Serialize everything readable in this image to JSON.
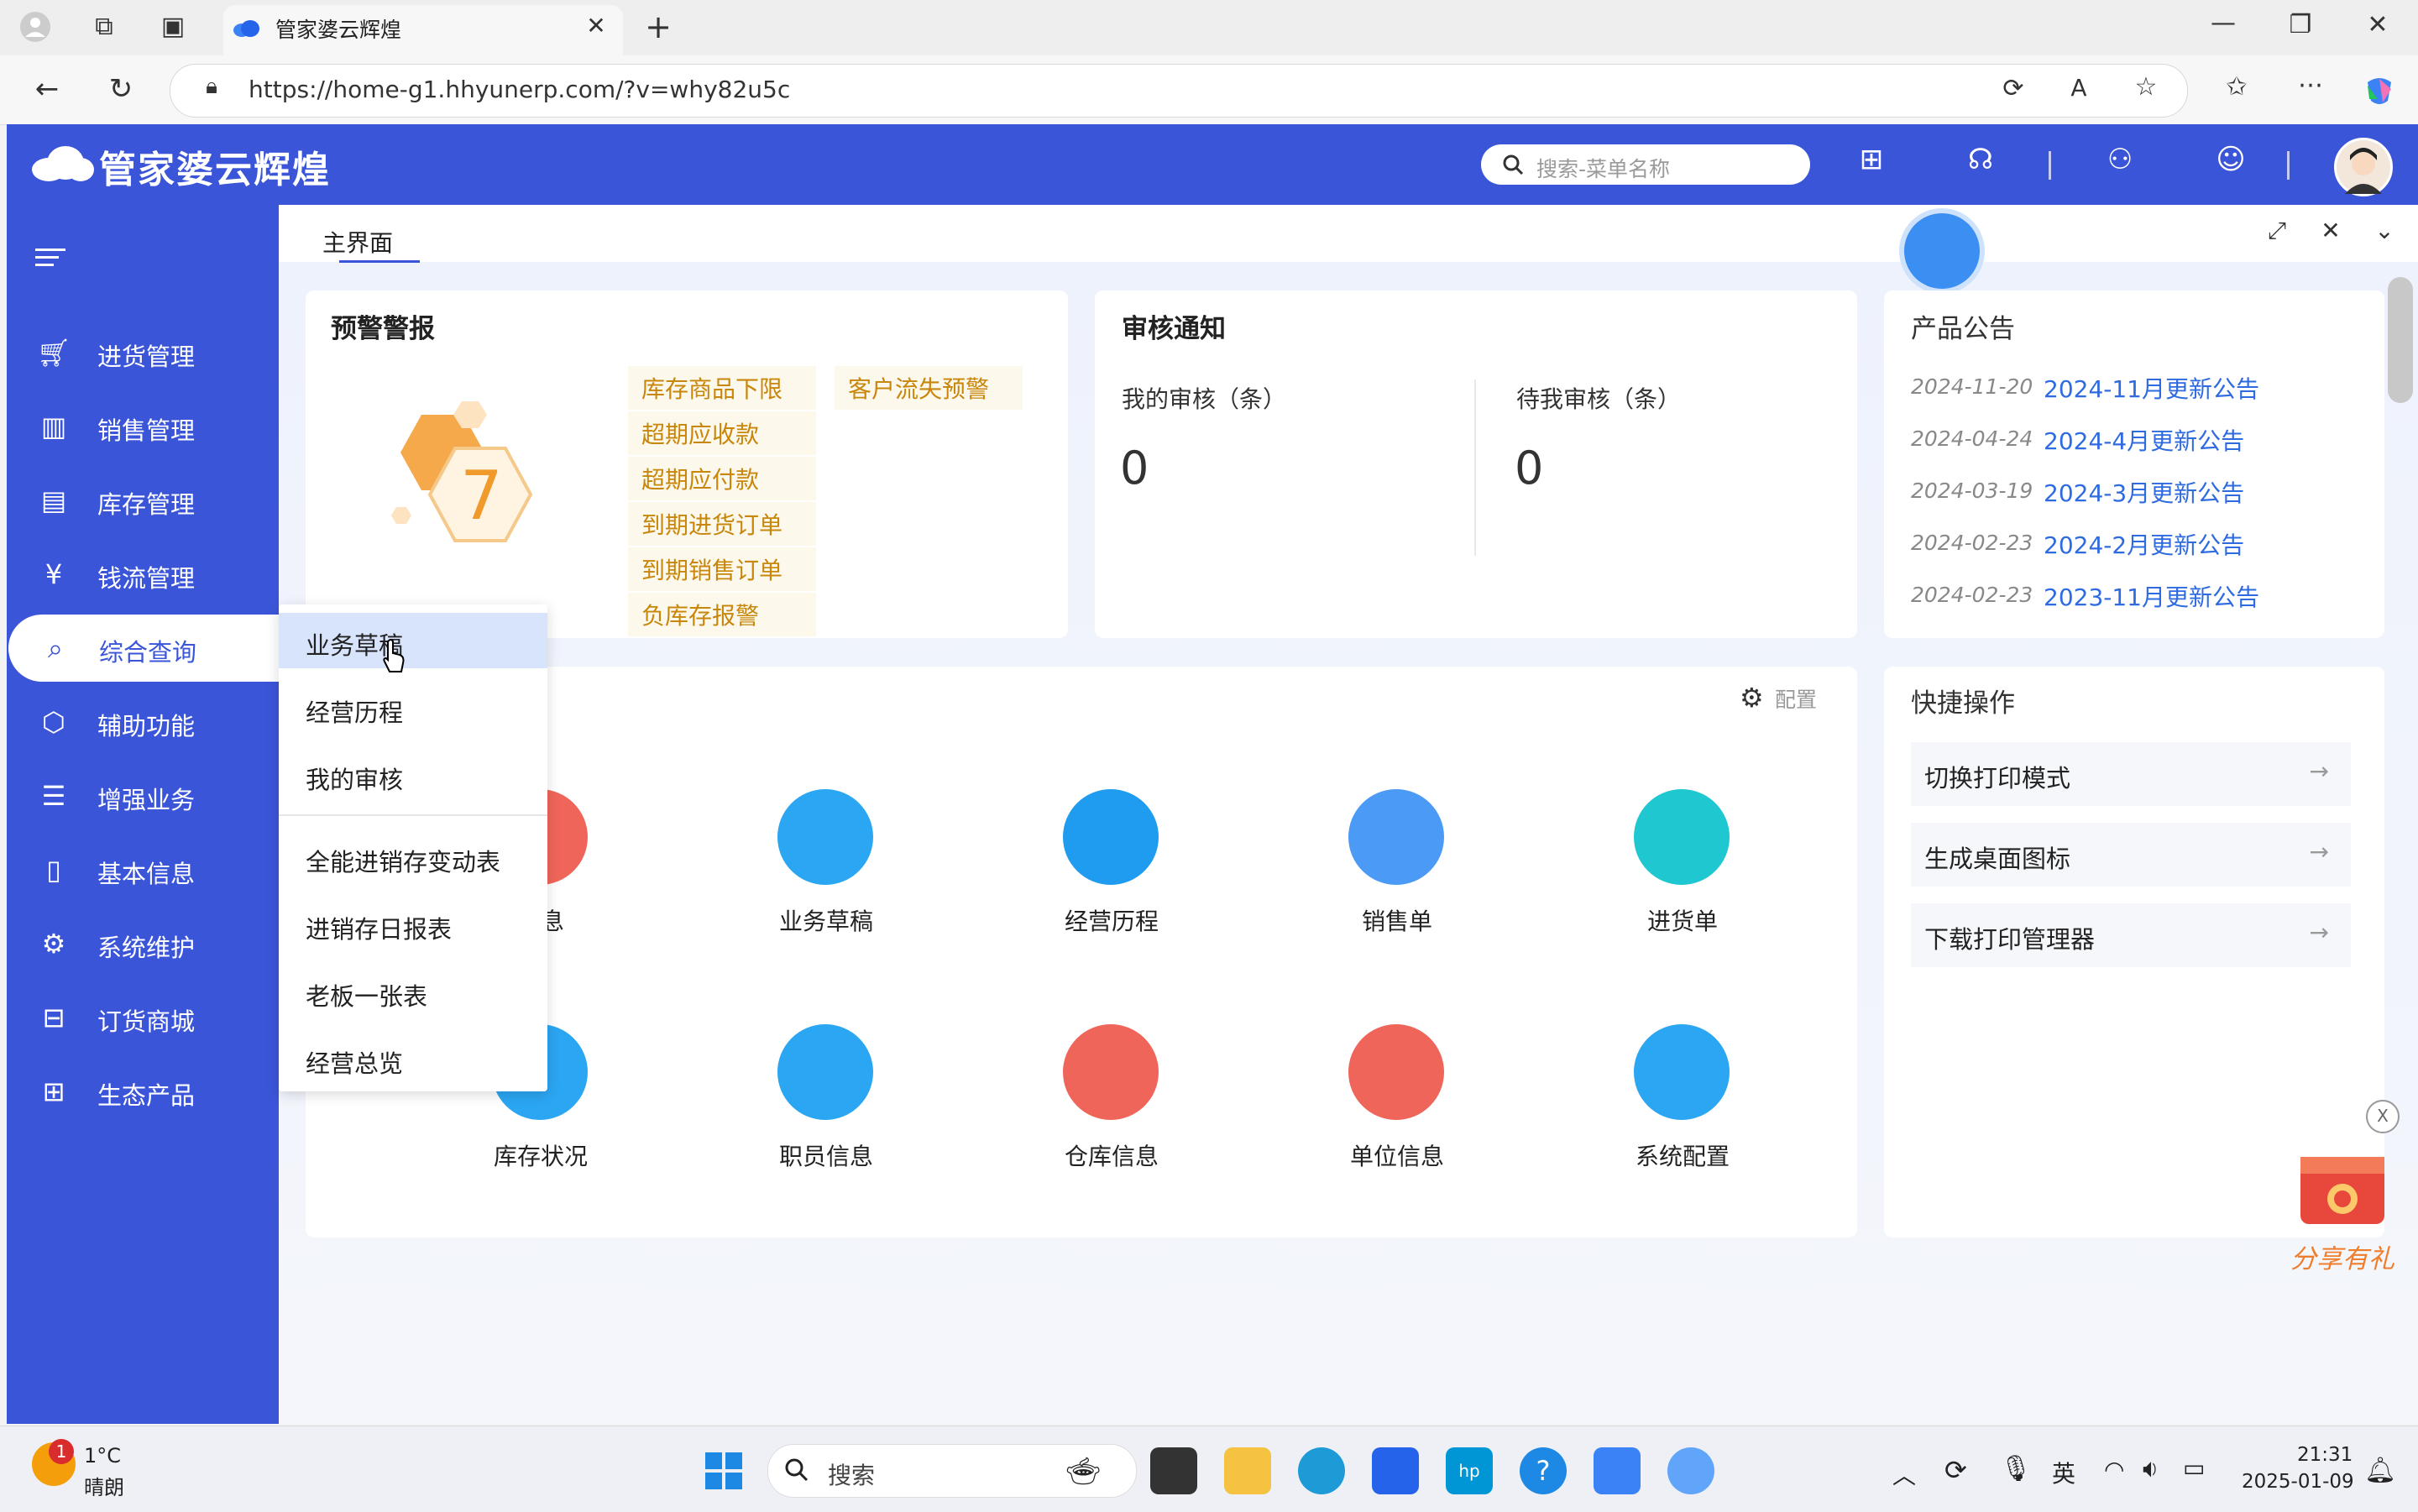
{
  "browser": {
    "tab_title": "管家婆云辉煌",
    "url": "https://home-g1.hhyunerp.com/?v=why82u5c"
  },
  "app": {
    "logo": "管家婆云辉煌",
    "search_placeholder": "搜索-菜单名称"
  },
  "sidebar": {
    "items": [
      {
        "label": "进货管理",
        "icon": "cart-icon"
      },
      {
        "label": "销售管理",
        "icon": "sales-chart-icon"
      },
      {
        "label": "库存管理",
        "icon": "inventory-box-icon"
      },
      {
        "label": "钱流管理",
        "icon": "money-bag-icon"
      },
      {
        "label": "综合查询",
        "icon": "search-doc-icon"
      },
      {
        "label": "辅助功能",
        "icon": "hexagon-icon"
      },
      {
        "label": "增强业务",
        "icon": "form-icon"
      },
      {
        "label": "基本信息",
        "icon": "document-icon"
      },
      {
        "label": "系统维护",
        "icon": "wrench-icon"
      },
      {
        "label": "订货商城",
        "icon": "shopping-bag-icon"
      },
      {
        "label": "生态产品",
        "icon": "apps-grid-icon"
      }
    ]
  },
  "main_tab": "主界面",
  "warning": {
    "title": "预警警报",
    "count": "7",
    "items_col1": [
      "库存商品下限",
      "超期应收款",
      "超期应付款",
      "到期进货订单",
      "到期销售订单",
      "负库存报警"
    ],
    "items_col2": [
      "客户流失预警"
    ]
  },
  "audit": {
    "title": "审核通知",
    "mine_label": "我的审核（条）",
    "mine_value": "0",
    "pending_label": "待我审核（条）",
    "pending_value": "0"
  },
  "notices": {
    "title": "产品公告",
    "items": [
      {
        "date": "2024-11-20",
        "title": "2024-11月更新公告"
      },
      {
        "date": "2024-04-24",
        "title": "2024-4月更新公告"
      },
      {
        "date": "2024-03-19",
        "title": "2024-3月更新公告"
      },
      {
        "date": "2024-02-23",
        "title": "2024-2月更新公告"
      },
      {
        "date": "2024-02-23",
        "title": "2023-11月更新公告"
      }
    ]
  },
  "shortcuts": {
    "config_label": "配置",
    "row1": [
      {
        "label": "信息",
        "color": "#f0655a"
      },
      {
        "label": "业务草稿",
        "color": "#2ba6f2"
      },
      {
        "label": "经营历程",
        "color": "#1f9cf0"
      },
      {
        "label": "销售单",
        "color": "#4a9af6"
      },
      {
        "label": "进货单",
        "color": "#1fc7d0"
      }
    ],
    "row2": [
      {
        "label": "库存状况",
        "color": "#2ba6f2"
      },
      {
        "label": "职员信息",
        "color": "#2ba6f2"
      },
      {
        "label": "仓库信息",
        "color": "#f0655a"
      },
      {
        "label": "单位信息",
        "color": "#f0655a"
      },
      {
        "label": "系统配置",
        "color": "#2ba6f2"
      }
    ]
  },
  "quick_ops": {
    "title": "快捷操作",
    "items": [
      "切换打印模式",
      "生成桌面图标",
      "下载打印管理器"
    ]
  },
  "dropdown": {
    "group1": [
      "业务草稿",
      "经营历程",
      "我的审核"
    ],
    "group2": [
      "全能进销存变动表",
      "进销存日报表",
      "老板一张表",
      "经营总览"
    ]
  },
  "promo": {
    "label": "分享有礼",
    "close": "X"
  },
  "taskbar": {
    "weather_temp": "1°C",
    "weather_desc": "晴朗",
    "weather_badge": "1",
    "search_label": "搜索",
    "ime": "英",
    "time": "21:31",
    "date": "2025-01-09"
  }
}
